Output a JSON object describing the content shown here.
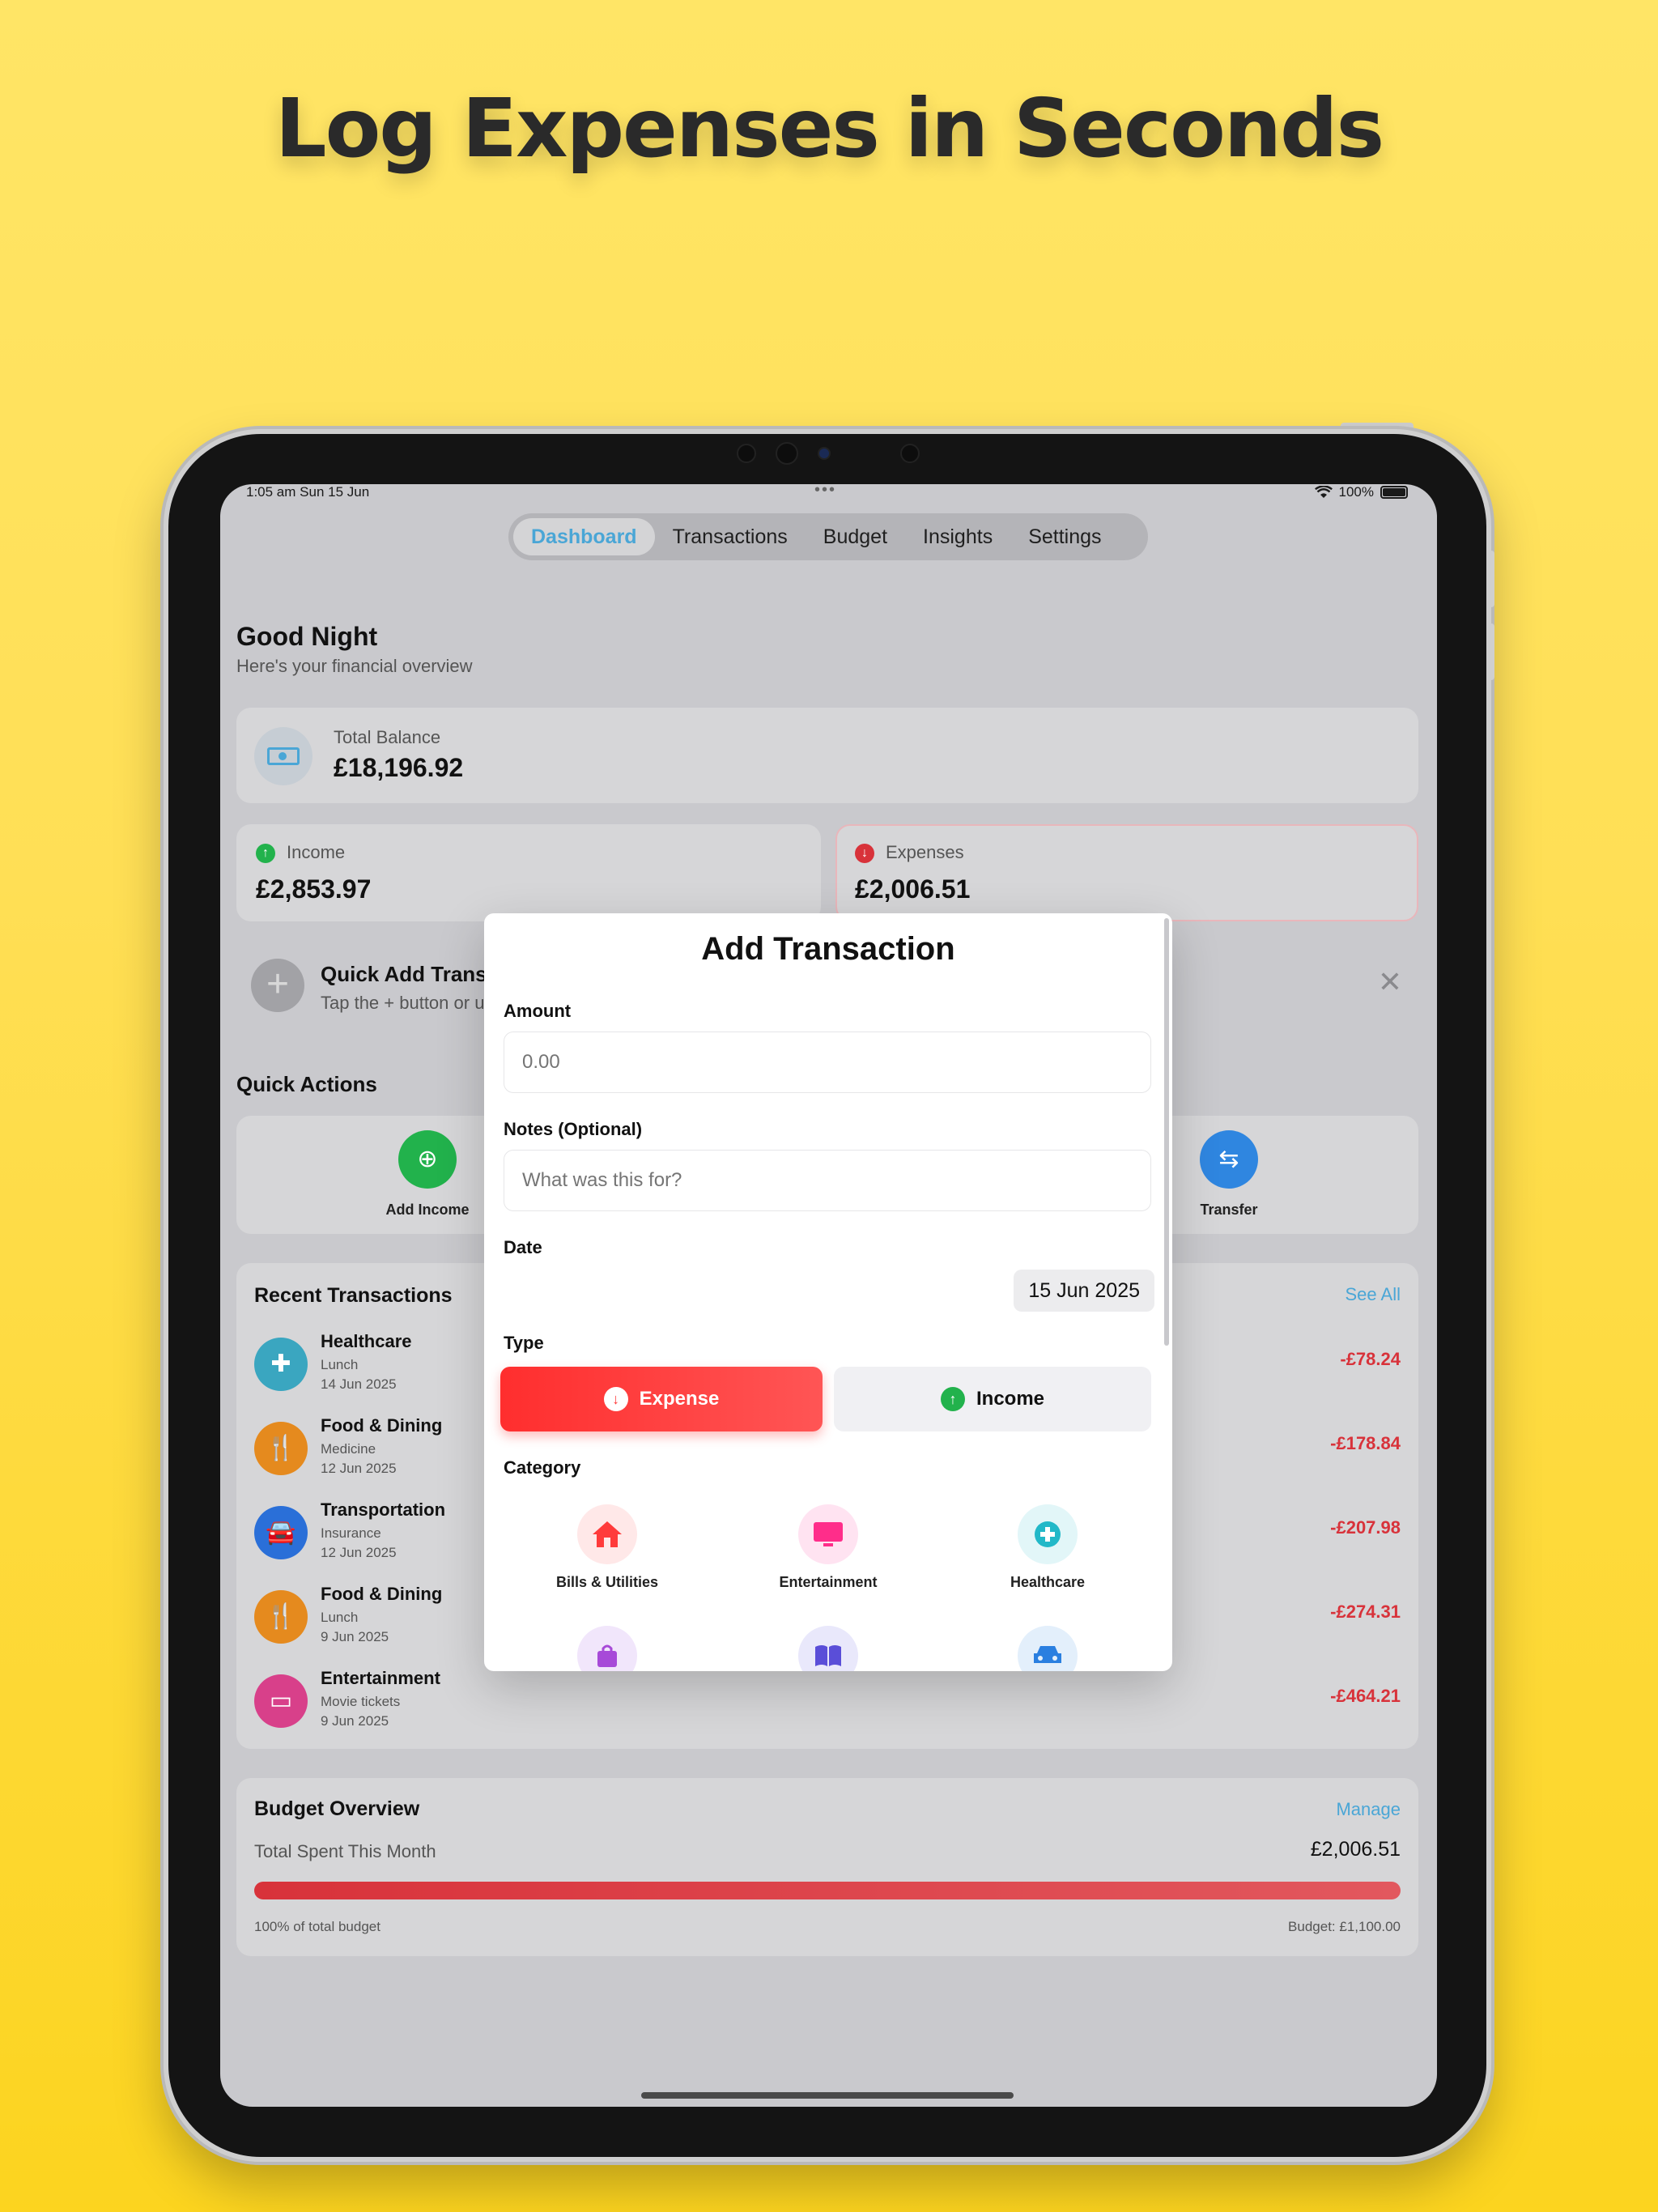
{
  "headline": "Log Expenses in Seconds",
  "status": {
    "time": "1:05 am   Sun 15 Jun",
    "battery": "100%"
  },
  "tabs": [
    {
      "label": "Dashboard",
      "active": true
    },
    {
      "label": "Transactions"
    },
    {
      "label": "Budget"
    },
    {
      "label": "Insights"
    },
    {
      "label": "Settings"
    }
  ],
  "greeting": {
    "title": "Good Night",
    "subtitle": "Here's your financial overview"
  },
  "balance": {
    "label": "Total Balance",
    "amount": "£18,196.92"
  },
  "income": {
    "label": "Income",
    "amount": "£2,853.97"
  },
  "expenses": {
    "label": "Expenses",
    "amount": "£2,006.51"
  },
  "quick_add": {
    "title": "Quick Add Transac",
    "subtitle": "Tap the + button or u"
  },
  "quick_actions": {
    "title": "Quick Actions",
    "add_income": "Add Income",
    "transfer": "Transfer"
  },
  "recent": {
    "title": "Recent Transactions",
    "see_all": "See All",
    "items": [
      {
        "name": "Healthcare",
        "note": "Lunch",
        "date": "14 Jun 2025",
        "amount": "-£78.24"
      },
      {
        "name": "Food & Dining",
        "note": "Medicine",
        "date": "12 Jun 2025",
        "amount": "-£178.84"
      },
      {
        "name": "Transportation",
        "note": "Insurance",
        "date": "12 Jun 2025",
        "amount": "-£207.98"
      },
      {
        "name": "Food & Dining",
        "note": "Lunch",
        "date": "9 Jun 2025",
        "amount": "-£274.31"
      },
      {
        "name": "Entertainment",
        "note": "Movie tickets",
        "date": "9 Jun 2025",
        "amount": "-£464.21"
      }
    ]
  },
  "budget": {
    "title": "Budget Overview",
    "manage": "Manage",
    "spent_label": "Total Spent This Month",
    "spent": "£2,006.51",
    "percent_label": "100% of total budget",
    "percent_used": 100,
    "budget_label": "Budget: £1,100.00"
  },
  "modal": {
    "title": "Add Transaction",
    "amount_label": "Amount",
    "amount_placeholder": "0.00",
    "notes_label": "Notes (Optional)",
    "notes_placeholder": "What was this for?",
    "date_label": "Date",
    "date_value": "15 Jun 2025",
    "type_label": "Type",
    "expense_label": "Expense",
    "income_label": "Income",
    "category_label": "Category",
    "categories": [
      "Bills & Utilities",
      "Entertainment",
      "Healthcare"
    ]
  },
  "colors": {
    "accent": "#4aa6d6",
    "expense": "#ff3b3b",
    "income": "#22b24c",
    "negative_amount": "#d8323a"
  }
}
